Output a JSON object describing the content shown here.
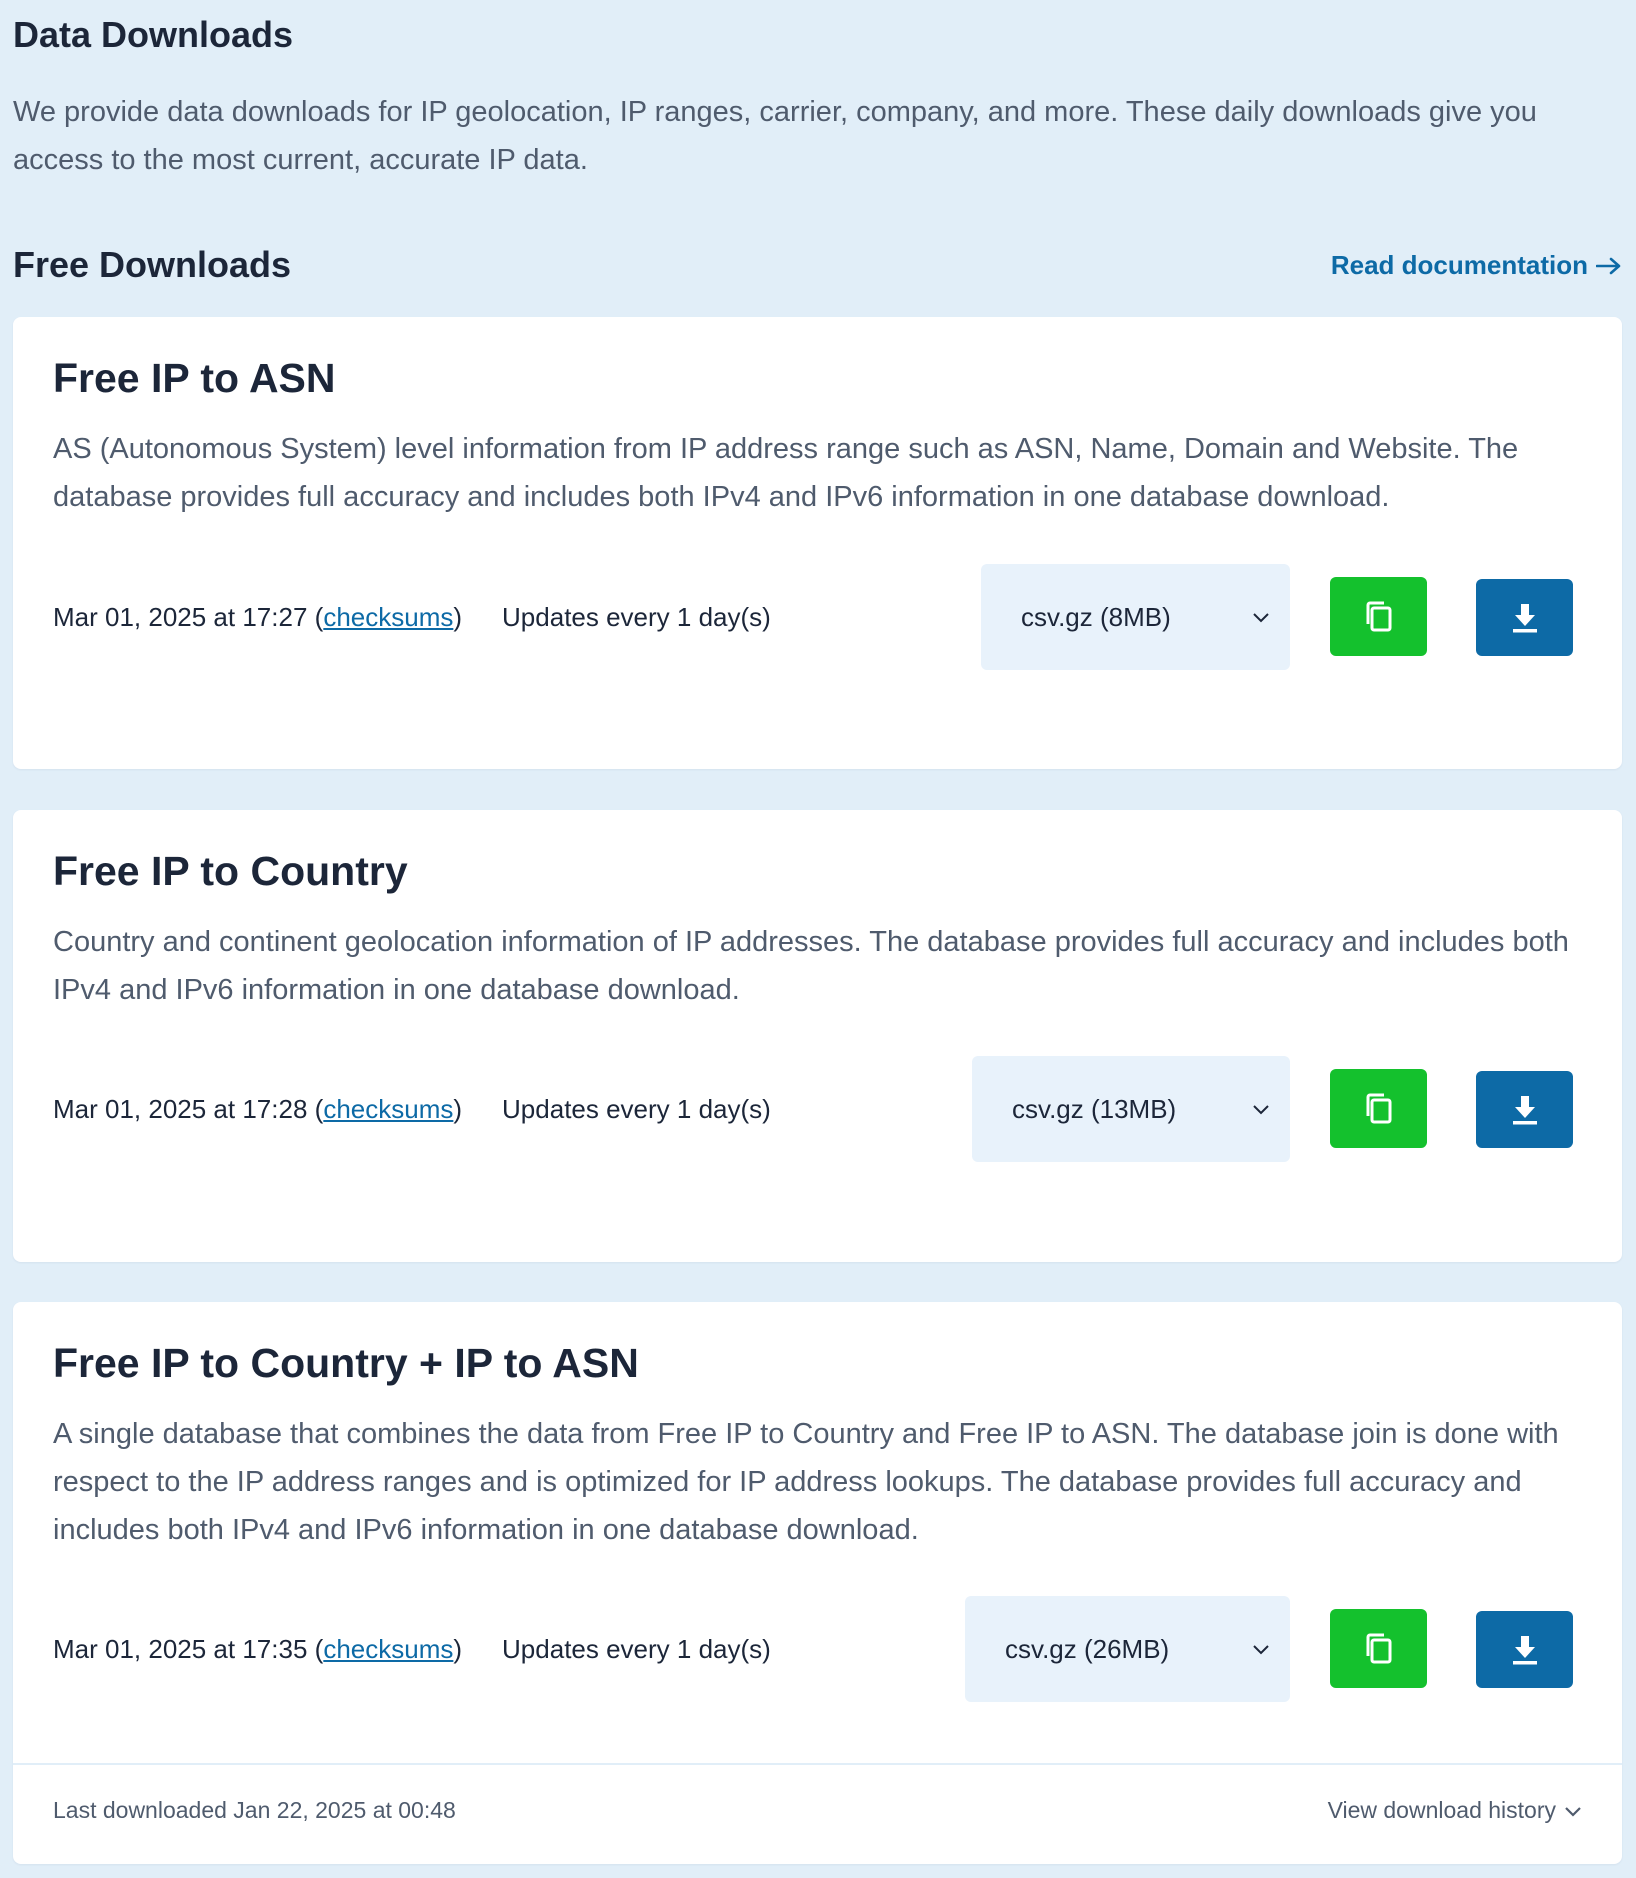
{
  "header": {
    "title": "Data Downloads",
    "intro": "We provide data downloads for IP geolocation, IP ranges, carrier, company, and more. These daily downloads give you access to the most current, accurate IP data."
  },
  "section": {
    "title": "Free Downloads",
    "doc_link": "Read documentation",
    "doc_link_icon": "arrow-right-icon"
  },
  "colors": {
    "page_bg": "#e1eef8",
    "copy_button": "#14c12d",
    "download_button": "#0d6aa6",
    "link": "#0d6aa6"
  },
  "cards": [
    {
      "title": "Free IP to ASN",
      "description": "AS (Autonomous System) level information from IP address range such as ASN, Name, Domain and Website. The database provides full accuracy and includes both IPv4 and IPv6 information in one database download.",
      "date": "Mar 01, 2025 at 17:27",
      "open_paren": "(",
      "checksums_label": "checksums",
      "close_paren": ")",
      "updates": "Updates every 1 day(s)",
      "format": "csv.gz (8MB)"
    },
    {
      "title": "Free IP to Country",
      "description": "Country and continent geolocation information of IP addresses. The database provides full accuracy and includes both IPv4 and IPv6 information in one database download.",
      "date": "Mar 01, 2025 at 17:28",
      "open_paren": "(",
      "checksums_label": "checksums",
      "close_paren": ")",
      "updates": "Updates every 1 day(s)",
      "format": "csv.gz (13MB)"
    },
    {
      "title": "Free IP to Country + IP to ASN",
      "description": "A single database that combines the data from Free IP to Country and Free IP to ASN. The database join is done with respect to the IP address ranges and is optimized for IP address lookups. The database provides full accuracy and includes both IPv4 and IPv6 information in one database download.",
      "date": "Mar 01, 2025 at 17:35",
      "open_paren": "(",
      "checksums_label": "checksums",
      "close_paren": ")",
      "updates": "Updates every 1 day(s)",
      "format": "csv.gz (26MB)"
    }
  ],
  "footer": {
    "last_downloaded": "Last downloaded Jan 22, 2025 at 00:48",
    "history_label": "View download history",
    "history_icon": "chevron-down-icon"
  },
  "icons": {
    "copy": "copy-icon",
    "download": "download-icon",
    "select": "chevron-down-icon"
  }
}
